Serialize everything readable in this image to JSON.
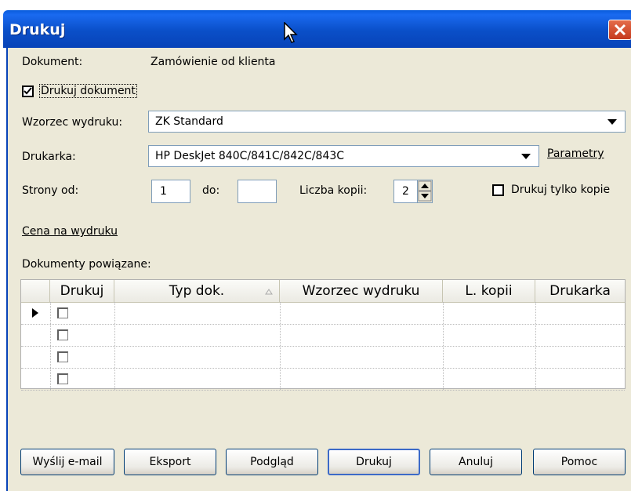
{
  "window": {
    "title": "Drukuj"
  },
  "form": {
    "dokument_label": "Dokument:",
    "dokument_value": "Zamówienie od klienta",
    "drukuj_dokument_label": "Drukuj dokument",
    "drukuj_dokument_checked": true,
    "wzorzec_label": "Wzorzec wydruku:",
    "wzorzec_value": "ZK Standard",
    "drukarka_label": "Drukarka:",
    "drukarka_value": "HP DeskJet 840C/841C/842C/843C",
    "parametry_link": "Parametry",
    "strony_od_label": "Strony od:",
    "strony_od_value": "1",
    "do_label": "do:",
    "do_value": "",
    "liczba_kopii_label": "Liczba kopii:",
    "liczba_kopii_value": "2",
    "tylko_kopie_label": "Drukuj tylko kopie",
    "tylko_kopie_checked": false,
    "cena_link": "Cena na wydruku",
    "powiazane_label": "Dokumenty powiązane:"
  },
  "grid": {
    "columns": [
      "Drukuj",
      "Typ dok.",
      "Wzorzec wydruku",
      "L. kopii",
      "Drukarka"
    ],
    "rows": [
      {
        "drukuj": false,
        "current": true
      },
      {
        "drukuj": false,
        "current": false
      },
      {
        "drukuj": false,
        "current": false
      },
      {
        "drukuj": false,
        "current": false
      }
    ]
  },
  "buttons": {
    "email": "Wyślij e-mail",
    "eksport": "Eksport",
    "podglad": "Podgląd",
    "drukuj": "Drukuj",
    "anuluj": "Anuluj",
    "pomoc": "Pomoc"
  },
  "colors": {
    "title_bar": "#0a4fc8",
    "dialog_bg": "#ece9d8",
    "close_button": "#d9512e"
  }
}
